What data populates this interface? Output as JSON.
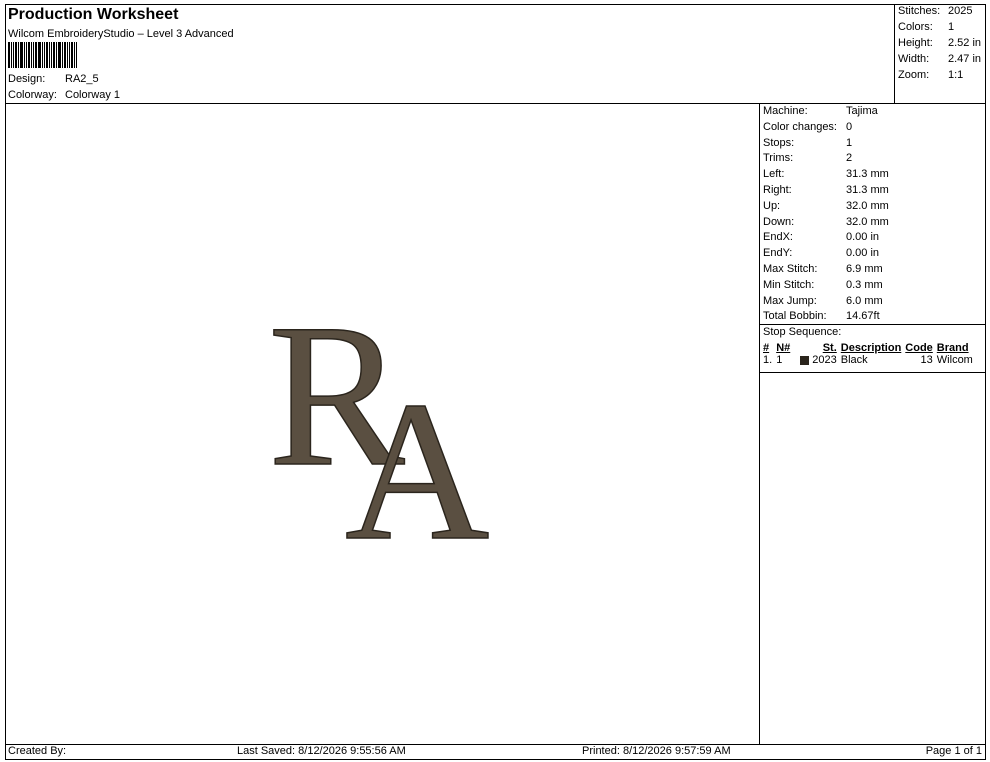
{
  "header": {
    "title": "Production Worksheet",
    "software": "Wilcom EmbroideryStudio – Level 3 Advanced",
    "design_label": "Design:",
    "design_value": "RA2_5",
    "colorway_label": "Colorway:",
    "colorway_value": "Colorway 1"
  },
  "summary": [
    {
      "label": "Stitches:",
      "value": "2025"
    },
    {
      "label": "Colors:",
      "value": "1"
    },
    {
      "label": "Height:",
      "value": "2.52 in"
    },
    {
      "label": "Width:",
      "value": "2.47 in"
    },
    {
      "label": "Zoom:",
      "value": "1:1"
    }
  ],
  "machine_info": [
    {
      "label": "Machine:",
      "value": "Tajima"
    },
    {
      "label": "Color changes:",
      "value": "0"
    },
    {
      "label": "Stops:",
      "value": "1"
    },
    {
      "label": "Trims:",
      "value": "2"
    },
    {
      "label": "Left:",
      "value": "31.3 mm"
    },
    {
      "label": "Right:",
      "value": "31.3 mm"
    },
    {
      "label": "Up:",
      "value": "32.0 mm"
    },
    {
      "label": "Down:",
      "value": "32.0 mm"
    },
    {
      "label": "EndX:",
      "value": "0.00 in"
    },
    {
      "label": "EndY:",
      "value": "0.00 in"
    },
    {
      "label": "Max Stitch:",
      "value": "6.9 mm"
    },
    {
      "label": "Min Stitch:",
      "value": "0.3 mm"
    },
    {
      "label": "Max Jump:",
      "value": "6.0 mm"
    },
    {
      "label": "Total Bobbin:",
      "value": "14.67ft"
    }
  ],
  "stop_sequence": {
    "title": "Stop Sequence:",
    "headers": {
      "num": "#",
      "n": "N#",
      "st": "St.",
      "description": "Description",
      "code": "Code",
      "brand": "Brand"
    },
    "rows": [
      {
        "num": "1.",
        "n": "1",
        "color": "#2a241c",
        "st": "2023",
        "description": "Black",
        "code": "13",
        "brand": "Wilcom"
      }
    ]
  },
  "design": {
    "glyphs": "RA",
    "thread_color": "#5a4f41",
    "outline_color": "#2b251d"
  },
  "footer": {
    "created_by": "Created By:",
    "last_saved": "Last Saved: 8/12/2026 9:55:56 AM",
    "printed": "Printed: 8/12/2026 9:57:59 AM",
    "page": "Page 1 of 1"
  }
}
